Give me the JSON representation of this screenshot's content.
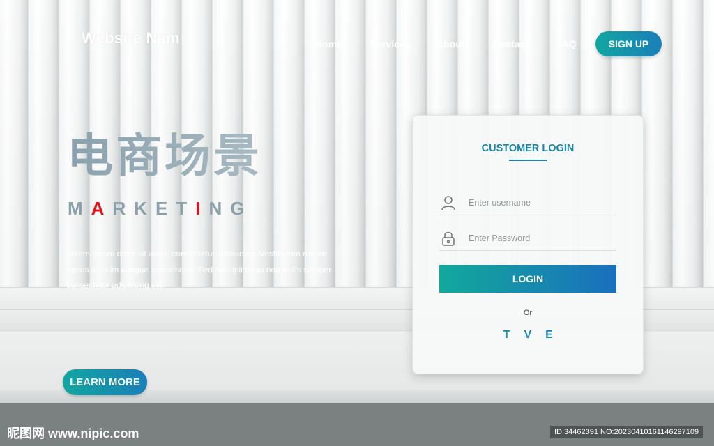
{
  "header": {
    "brand": "Website Nam",
    "nav": [
      "Home",
      "Services",
      "About",
      "Contact",
      "FAQ"
    ],
    "signup_label": "SIGN UP"
  },
  "hero": {
    "title": "电商场景",
    "subtitle_parts": [
      "M",
      "A",
      "RKET",
      "I",
      "NG"
    ],
    "body": "Lorem ipsum dolor sit amet, consectetur adipiscing. Vestibulum rutrum metus at enim congue scelerisque. Sed suscipit metu non iculis semper consectetur adipiscing elit.",
    "learn_more_label": "LEARN MORE"
  },
  "login": {
    "title": "CUSTOMER LOGIN",
    "username_placeholder": "Enter username",
    "password_placeholder": "Enter Password",
    "button_label": "LOGIN",
    "or_label": "Or",
    "socials": [
      "T",
      "V",
      "E"
    ]
  },
  "watermark": {
    "left": "昵图网 www.nipic.com",
    "right": "ID:34462391 NO:20230410161146297109"
  },
  "colors": {
    "accent_start": "#12a6a1",
    "accent_end": "#1a7fb8",
    "highlight_red": "#e3131b",
    "title_teal": "#1a86a8"
  },
  "icons": {
    "username": "user-icon",
    "password": "lock-icon"
  }
}
